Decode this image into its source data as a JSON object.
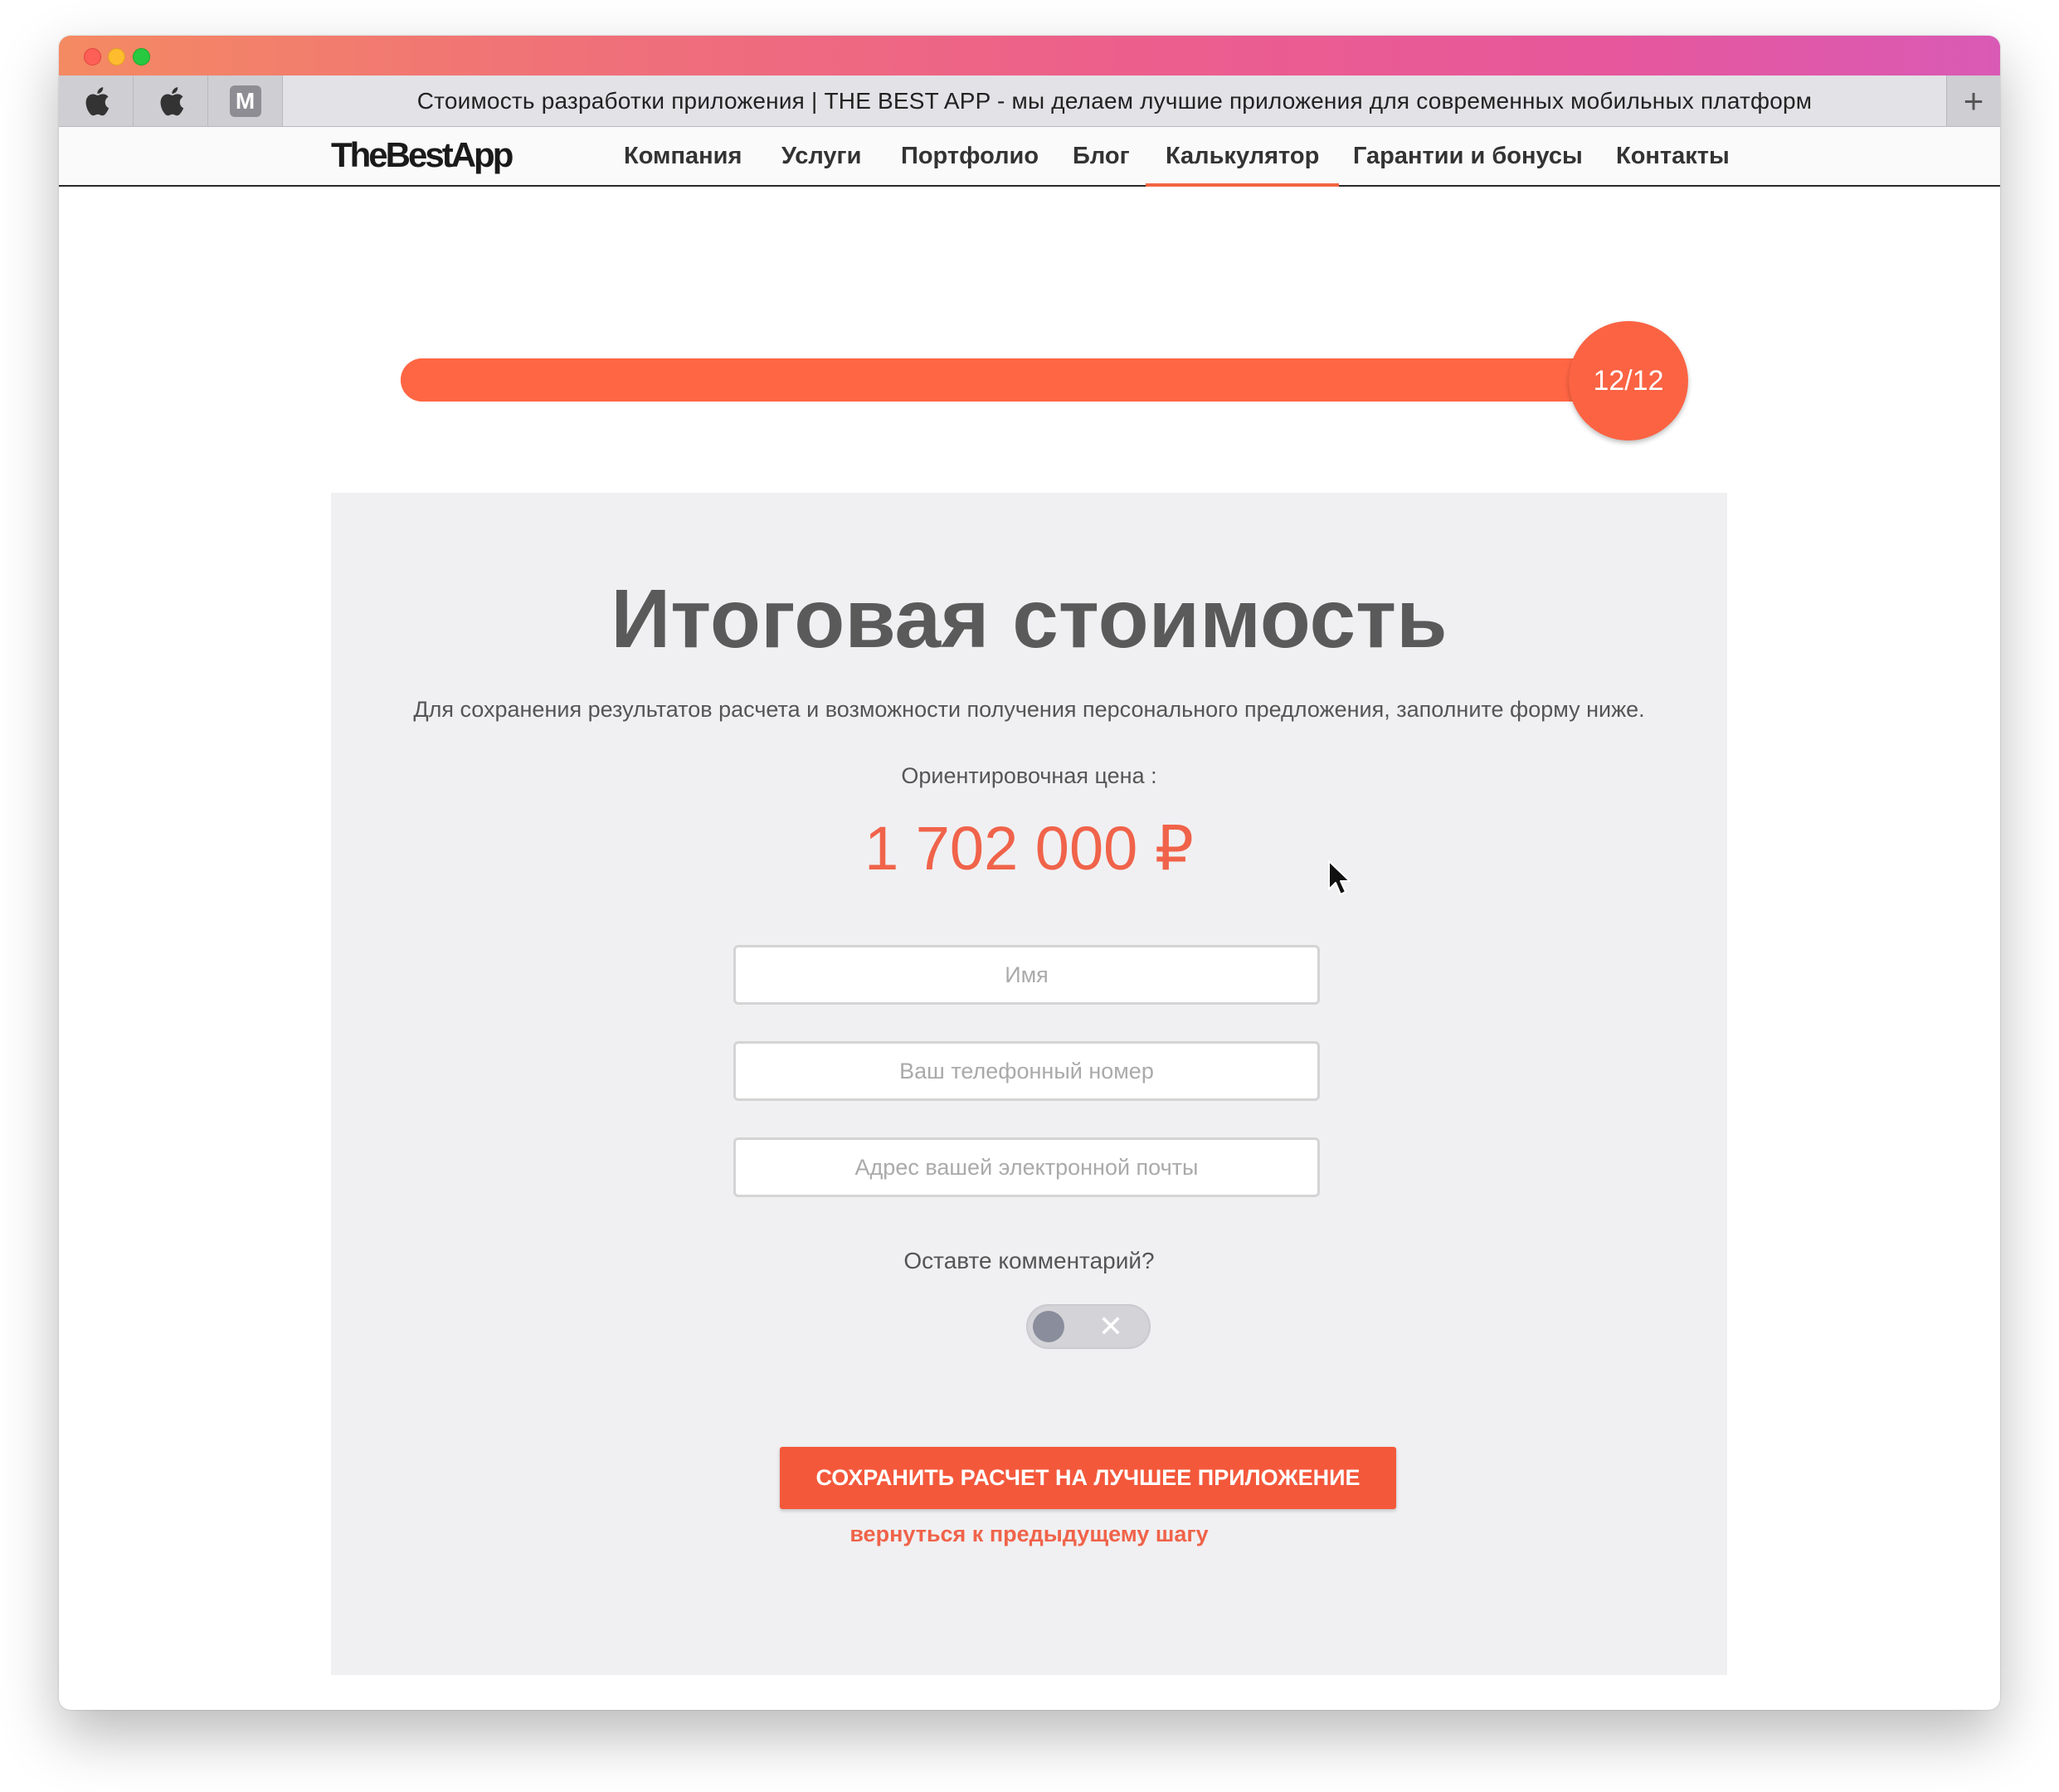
{
  "browser": {
    "active_tab_title": "Стоимость разработки приложения | THE BEST APP - мы делаем лучшие приложения для современных мобильных платформ",
    "pinned_tabs": [
      {
        "icon": "apple-logo-icon"
      },
      {
        "icon": "apple-logo-icon"
      },
      {
        "icon": "m-letter-icon",
        "label": "M"
      }
    ],
    "new_tab_label": "+"
  },
  "site_nav": {
    "logo": "TheBestApp",
    "items": [
      {
        "label": "Компания"
      },
      {
        "label": "Услуги"
      },
      {
        "label": "Портфолио"
      },
      {
        "label": "Блог"
      },
      {
        "label": "Калькулятор",
        "active": true
      },
      {
        "label": "Гарантии и бонусы"
      },
      {
        "label": "Контакты"
      }
    ]
  },
  "progress": {
    "label": "12/12",
    "current": 12,
    "total": 12,
    "fraction": 1.0
  },
  "result": {
    "title": "Итоговая стоимость",
    "description": "Для сохранения результатов расчета и возможности получения персонального предложения, заполните форму ниже.",
    "price_label": "Ориентировочная цена :",
    "price": "1 702 000 ₽"
  },
  "form": {
    "name_placeholder": "Имя",
    "phone_placeholder": "Ваш телефонный номер",
    "email_placeholder": "Адрес вашей электронной почты",
    "comment_label": "Оставте комментарий?",
    "comment_toggle": {
      "on": false,
      "off_symbol": "✕"
    },
    "submit_label": "СОХРАНИТЬ РАСЧЕТ НА ЛУЧШЕЕ ПРИЛОЖЕНИЕ",
    "back_label": "вернуться к предыдущему шагу"
  },
  "colors": {
    "accent": "#ff6644",
    "price": "#f0634a",
    "button": "#f4583b",
    "card_bg": "#f0f0f2"
  }
}
